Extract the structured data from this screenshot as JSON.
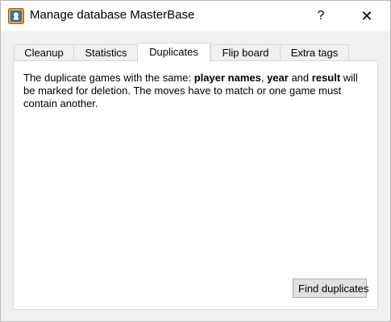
{
  "window": {
    "title": "Manage database MasterBase",
    "help_label": "?",
    "close_label": "✕",
    "app_icon": "chess-database-icon"
  },
  "tabs": [
    {
      "label": "Cleanup",
      "active": false
    },
    {
      "label": "Statistics",
      "active": false
    },
    {
      "label": "Duplicates",
      "active": true
    },
    {
      "label": "Flip board",
      "active": false
    },
    {
      "label": "Extra tags",
      "active": false
    }
  ],
  "duplicates": {
    "text_part1": "The duplicate games with the same: ",
    "field_players": "player names",
    "sep1": ", ",
    "field_year": "year",
    "sep2": " and ",
    "field_result": "result",
    "text_part2": " will be marked for deletion. The moves have to match or one game must contain another.",
    "find_button": "Find duplicates"
  }
}
